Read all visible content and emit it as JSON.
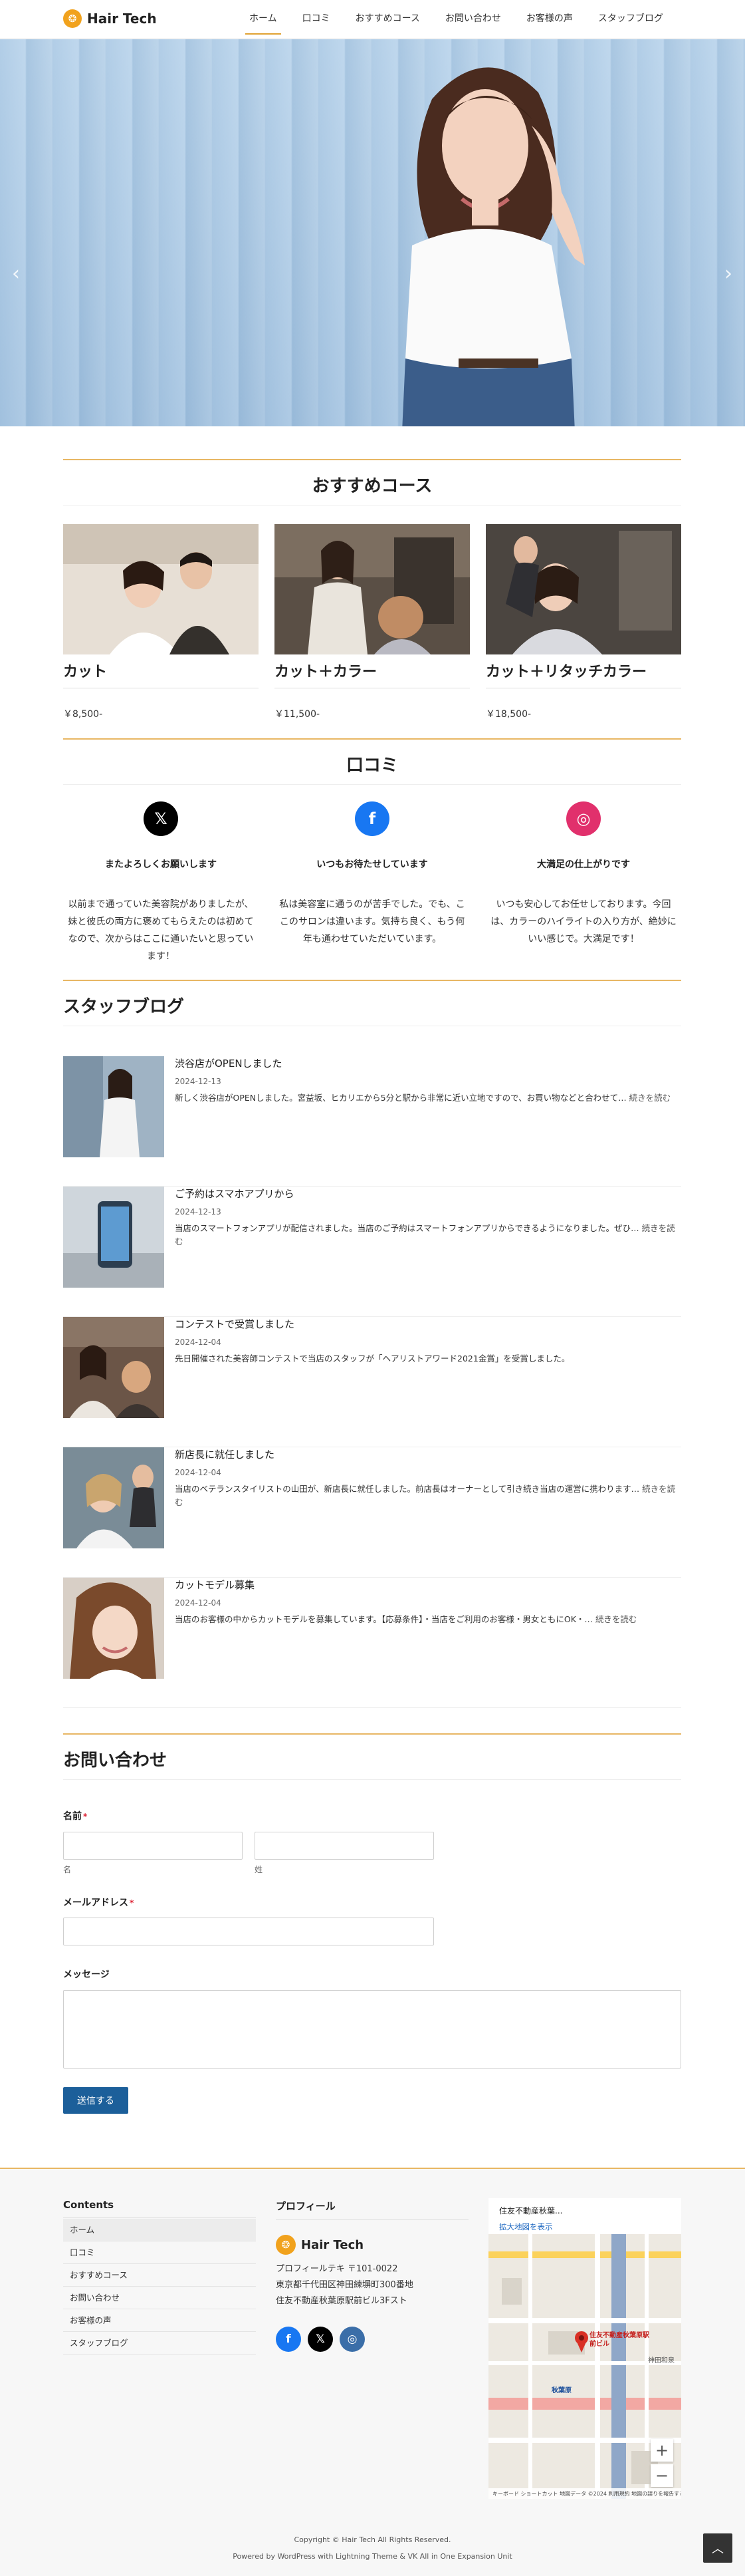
{
  "site": {
    "logo_mark": "❂",
    "name": "Hair Tech"
  },
  "nav": [
    {
      "label": "ホーム",
      "active": true
    },
    {
      "label": "口コミ"
    },
    {
      "label": "おすすめコース"
    },
    {
      "label": "お問い合わせ"
    },
    {
      "label": "お客様の声"
    },
    {
      "label": "スタッフブログ"
    }
  ],
  "hero": {
    "prev_icon": "chevron-left-icon",
    "next_icon": "chevron-right-icon",
    "slide_count": 2,
    "active_slide": 1
  },
  "courses": {
    "title": "おすすめコース",
    "items": [
      {
        "name": "カット",
        "price": "￥8,500-"
      },
      {
        "name": "カット＋カラー",
        "price": "￥11,500-"
      },
      {
        "name": "カット＋リタッチカラー",
        "price": "￥18,500-"
      }
    ]
  },
  "reviews": {
    "title": "口コミ",
    "items": [
      {
        "icon": "x-icon",
        "icon_glyph": "𝕏",
        "color": "#000000",
        "title": "またよろしくお願いします",
        "text": "以前まで通っていた美容院がありましたが、妹と彼氏の両方に褒めてもらえたのは初めてなので、次からはここに通いたいと思っています！"
      },
      {
        "icon": "facebook-icon",
        "icon_glyph": "f",
        "color": "#1877f2",
        "title": "いつもお待たせしています",
        "text": "私は美容室に通うのが苦手でした。でも、ここのサロンは違います。気持ち良く、もう何年も通わせていただいています。"
      },
      {
        "icon": "instagram-icon",
        "icon_glyph": "◎",
        "color": "#e1306c",
        "title": "大満足の仕上がりです",
        "text": "いつも安心してお任せしております。今回は、カラーのハイライトの入り方が、絶妙にいい感じで。大満足です！"
      }
    ]
  },
  "blog": {
    "title": "スタッフブログ",
    "posts": [
      {
        "title": "渋谷店がOPENしました",
        "date": "2024-12-13",
        "excerpt": "新しく渋谷店がOPENしました。宮益坂、ヒカリエから5分と駅から非常に近い立地ですので、お買い物などと合わせて…",
        "more": "続きを読む"
      },
      {
        "title": "ご予約はスマホアプリから",
        "date": "2024-12-13",
        "excerpt": "当店のスマートフォンアプリが配信されました。当店のご予約はスマートフォンアプリからできるようになりました。ぜひ…",
        "more": "続きを読む"
      },
      {
        "title": "コンテストで受賞しました",
        "date": "2024-12-04",
        "excerpt": "先日開催された美容師コンテストで当店のスタッフが「ヘアリストアワード2021金賞」を受賞しました。",
        "more": ""
      },
      {
        "title": "新店長に就任しました",
        "date": "2024-12-04",
        "excerpt": "当店のベテランスタイリストの山田が、新店長に就任しました。前店長はオーナーとして引き続き当店の運営に携わります…",
        "more": "続きを読む"
      },
      {
        "title": "カットモデル募集",
        "date": "2024-12-04",
        "excerpt": "当店のお客様の中からカットモデルを募集しています。【応募条件】・当店をご利用のお客様・男女ともにOK・…",
        "more": "続きを読む"
      }
    ]
  },
  "contact": {
    "title": "お問い合わせ",
    "name_label": "名前",
    "required_mark": "*",
    "first_sublabel": "名",
    "last_sublabel": "姓",
    "email_label": "メールアドレス",
    "message_label": "メッセージ",
    "submit_label": "送信する"
  },
  "footer": {
    "menu_title": "Contents",
    "menu": [
      "ホーム",
      "口コミ",
      "おすすめコース",
      "お問い合わせ",
      "お客様の声",
      "スタッフブログ"
    ],
    "profile_title": "プロフィール",
    "profile_lines": [
      "プロフィールテキ 〒101-0022",
      "東京都千代田区神田練塀町300番地",
      "住友不動産秋葉原駅前ビル3Fスト"
    ],
    "social": [
      {
        "icon": "facebook-icon",
        "glyph": "f",
        "color": "#1877f2"
      },
      {
        "icon": "x-icon",
        "glyph": "𝕏",
        "color": "#000000"
      },
      {
        "icon": "instagram-icon",
        "glyph": "◎",
        "color": "#3b6ea8"
      }
    ],
    "map": {
      "place": "住友不動産秋葉...",
      "link": "拡大地図を表示",
      "pin_label": "住友不動産秋葉原駅前ビル",
      "station_1": "秋葉原",
      "station_2": "神田和泉",
      "credit": "キーボード ショートカット 地図データ ©2024 利用規約 地図の誤りを報告する"
    },
    "copyright": "Copyright © Hair Tech All Rights Reserved.",
    "powered": "Powered by WordPress with Lightning Theme & VK All in One Expansion Unit"
  },
  "colors": {
    "accent": "#e8b764",
    "button": "#1c5f9a",
    "instagram": "#e1306c",
    "facebook": "#1877f2"
  }
}
